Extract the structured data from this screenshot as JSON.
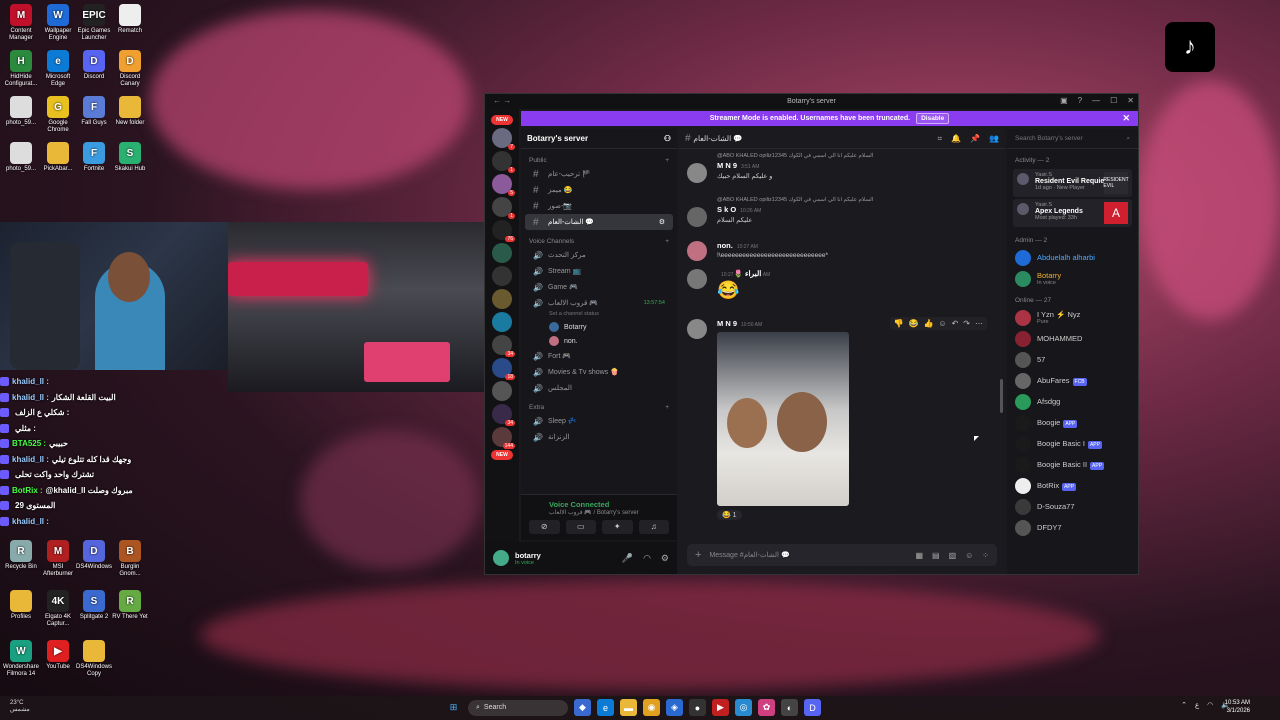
{
  "desktop": {
    "icons": [
      {
        "label": "Content Manager",
        "color": "#c0102a",
        "glyph": "M"
      },
      {
        "label": "Wallpaper Engine",
        "color": "#1e6ad6",
        "glyph": "W"
      },
      {
        "label": "Epic Games Launcher",
        "color": "#222",
        "glyph": "EPIC"
      },
      {
        "label": "Rematch",
        "color": "#eee",
        "glyph": ""
      },
      {
        "label": "HidHide Configurat...",
        "color": "#2b8a3e",
        "glyph": "H"
      },
      {
        "label": "Microsoft Edge",
        "color": "#0b7bd6",
        "glyph": "e"
      },
      {
        "label": "Discord",
        "color": "#5865f2",
        "glyph": "D"
      },
      {
        "label": "Discord Canary",
        "color": "#f0a030",
        "glyph": "D"
      },
      {
        "label": "photo_59...",
        "color": "#ddd",
        "glyph": ""
      },
      {
        "label": "Google Chrome",
        "color": "#e8c020",
        "glyph": "G"
      },
      {
        "label": "Fall Guys",
        "color": "#5a7bd6",
        "glyph": "F"
      },
      {
        "label": "New folder",
        "color": "#e9b838",
        "glyph": ""
      },
      {
        "label": "photo_59...",
        "color": "#ddd",
        "glyph": ""
      },
      {
        "label": "PickAbar...",
        "color": "#e9b838",
        "glyph": ""
      },
      {
        "label": "Fortnite",
        "color": "#3b9be0",
        "glyph": "F"
      },
      {
        "label": "Skakui Hub",
        "color": "#2ab070",
        "glyph": "S"
      },
      {
        "label": "Recycle Bin",
        "color": "#8aa",
        "glyph": "R"
      },
      {
        "label": "MSI Afterburner",
        "color": "#b02020",
        "glyph": "M"
      },
      {
        "label": "DS4Windows",
        "color": "#5566dd",
        "glyph": "D"
      },
      {
        "label": "Burglin Gnom...",
        "color": "#aa5522",
        "glyph": "B"
      },
      {
        "label": "Profiles",
        "color": "#e9b838",
        "glyph": ""
      },
      {
        "label": "Elgato 4K Captur...",
        "color": "#222",
        "glyph": "4K"
      },
      {
        "label": "Splitgate 2",
        "color": "#3a6ad0",
        "glyph": "S"
      },
      {
        "label": "RV There Yet",
        "color": "#66aa44",
        "glyph": "R"
      },
      {
        "label": "Wondershare Filmora 14",
        "color": "#1aa080",
        "glyph": "W"
      },
      {
        "label": "YouTube",
        "color": "#e02020",
        "glyph": "▶"
      },
      {
        "label": "DS4Windows Copy",
        "color": "#e9b838",
        "glyph": ""
      }
    ]
  },
  "stream_chat": [
    {
      "name": "khalid_ll :",
      "text": "",
      "style": "nm"
    },
    {
      "name": "khalid_ll :",
      "text": "البيت القلعة الشكار",
      "style": "nm"
    },
    {
      "name": "",
      "text": "شكلي ع الزلف :",
      "style": "nm red"
    },
    {
      "name": "",
      "text": "مثلي :",
      "style": "nm red"
    },
    {
      "name": "BTA525 :",
      "text": "حبيبي",
      "style": "nm green"
    },
    {
      "name": "khalid_ll :",
      "text": "وجهك قدا كله تتلوع تيلي",
      "style": "nm"
    },
    {
      "name": "",
      "text": "تشترك واحد واكت تحلى",
      "style": "nm red"
    },
    {
      "name": "BotRix :",
      "text": "@khalid_ll مبروك وصلت",
      "style": "nm green"
    },
    {
      "name": "",
      "text": "المستوى 29",
      "style": "nm"
    },
    {
      "name": "khalid_ll :",
      "text": "",
      "style": "nm"
    }
  ],
  "discord": {
    "window_title": "Botarry's server",
    "banner_text": "Streamer Mode is enabled. Usernames have been truncated.",
    "banner_button": "Disable",
    "server_list_new": "NEW",
    "server_name": "Botarry's server",
    "categories": {
      "public": "Public",
      "voice": "Voice Channels",
      "extra": "Extra"
    },
    "text_channels": [
      {
        "name": "ترحيب-عام 🏴",
        "active": false
      },
      {
        "name": "ميمز 😂",
        "active": false
      },
      {
        "name": "صور-📷",
        "active": false
      },
      {
        "name": "الشات-العام 💬",
        "active": true
      }
    ],
    "voice_channels": [
      {
        "name": "مركز التحدث"
      },
      {
        "name": "Stream 📺"
      },
      {
        "name": "Game 🎮"
      },
      {
        "name": "قروب الالعاب 🎮",
        "timer": "13:57:54",
        "status": "Set a channel status"
      }
    ],
    "voice_users": [
      {
        "name": "Botarry",
        "color": "#3a6a9a"
      },
      {
        "name": "non.",
        "color": "#c07080"
      }
    ],
    "voice_channels2": [
      {
        "name": "Fort 🎮"
      },
      {
        "name": "Movies & Tv shows 🍿"
      },
      {
        "name": "المجلس"
      }
    ],
    "extra_channels": [
      {
        "name": "Sleep 💤"
      },
      {
        "name": "الزنزانة"
      }
    ],
    "voice_connected": "Voice Connected",
    "voice_sub": "قروب الالعاب 🎮 / Botarry's server",
    "user": {
      "name": "botarry",
      "status": "In voice"
    },
    "channel_header": "الشات-العام 💬",
    "messages": [
      {
        "reply": "@ABO KHALED opiliz12345 السلام عليكم انا الي اسمي في الكوك",
        "author": "M N 9",
        "time": "3:51 AM",
        "text": "و عليكم السلام حبيك",
        "color": "#888"
      },
      {
        "reply": "@ABO KHALED opiliz12345 السلام عليكم انا الي اسمي في الكوك",
        "author": "S k O",
        "time": "10:26 AM",
        "text": "عليكم السلام",
        "color": "#666"
      },
      {
        "reply": "",
        "author": "non.",
        "time": "10:27 AM",
        "text": "!\\eeeeeeeeeeeeeeeeeeeeeeeeeeeee*",
        "color": "#c07080"
      },
      {
        "reply": "",
        "author": "البراء 🌷",
        "time": "10:27 AM",
        "text": "😂",
        "color": "#777",
        "emoji": true
      },
      {
        "reply": "",
        "author": "M N 9",
        "time": "10:50 AM",
        "text": "",
        "color": "#888",
        "image": true,
        "reaction": "😂 1"
      }
    ],
    "composer_placeholder": "Message #الشات-العام 💬",
    "search_placeholder": "Search Botarry's server",
    "activity_header": "Activity — 2",
    "activities": [
      {
        "name": "Yasir.S",
        "game": "Resident Evil Requiem",
        "detail": "1d ago · New Player",
        "art": "RESIDENT EVIL"
      },
      {
        "name": "Yasir.S",
        "game": "Apex Legends",
        "detail": "Most played: 33h",
        "art": "A"
      }
    ],
    "admin_header": "Admin — 2",
    "admins": [
      {
        "name": "Abduelalh alharbi",
        "sub": "",
        "color": "#1e6ad6",
        "namecolor": "#4aa8ff"
      },
      {
        "name": "Botarry",
        "sub": "In voice",
        "color": "#2a8a60",
        "namecolor": "#f0b030"
      }
    ],
    "online_header": "Online — 27",
    "online": [
      {
        "name": "I Yzn ⚡ Nyz",
        "sub": "Pure",
        "tag": "",
        "color": "#aa3344"
      },
      {
        "name": "MOHAMMED",
        "sub": "",
        "tag": "",
        "color": "#882233"
      },
      {
        "name": "57",
        "sub": "",
        "tag": "",
        "color": "#555"
      },
      {
        "name": "AbuFares",
        "sub": "",
        "tag": "FCB",
        "color": "#666"
      },
      {
        "name": "Afsdgg",
        "sub": "",
        "tag": "",
        "color": "#2a9a5a"
      },
      {
        "name": "Boogie",
        "sub": "",
        "tag": "APP",
        "color": "#1a1a1a"
      },
      {
        "name": "Boogie Basic I",
        "sub": "",
        "tag": "APP",
        "color": "#1a1a1a"
      },
      {
        "name": "Boogie Basic II",
        "sub": "",
        "tag": "APP",
        "color": "#1a1a1a"
      },
      {
        "name": "BotRix",
        "sub": "",
        "tag": "APP",
        "color": "#eee"
      },
      {
        "name": "D-Souza77",
        "sub": "",
        "tag": "",
        "color": "#3a3a3a"
      },
      {
        "name": "DFDY7",
        "sub": "",
        "tag": "",
        "color": "#555"
      }
    ]
  },
  "taskbar": {
    "weather_temp": "23°C",
    "weather_desc": "مشمس",
    "search_label": "Search",
    "time": "10:53 AM",
    "date": "3/1/2026"
  }
}
